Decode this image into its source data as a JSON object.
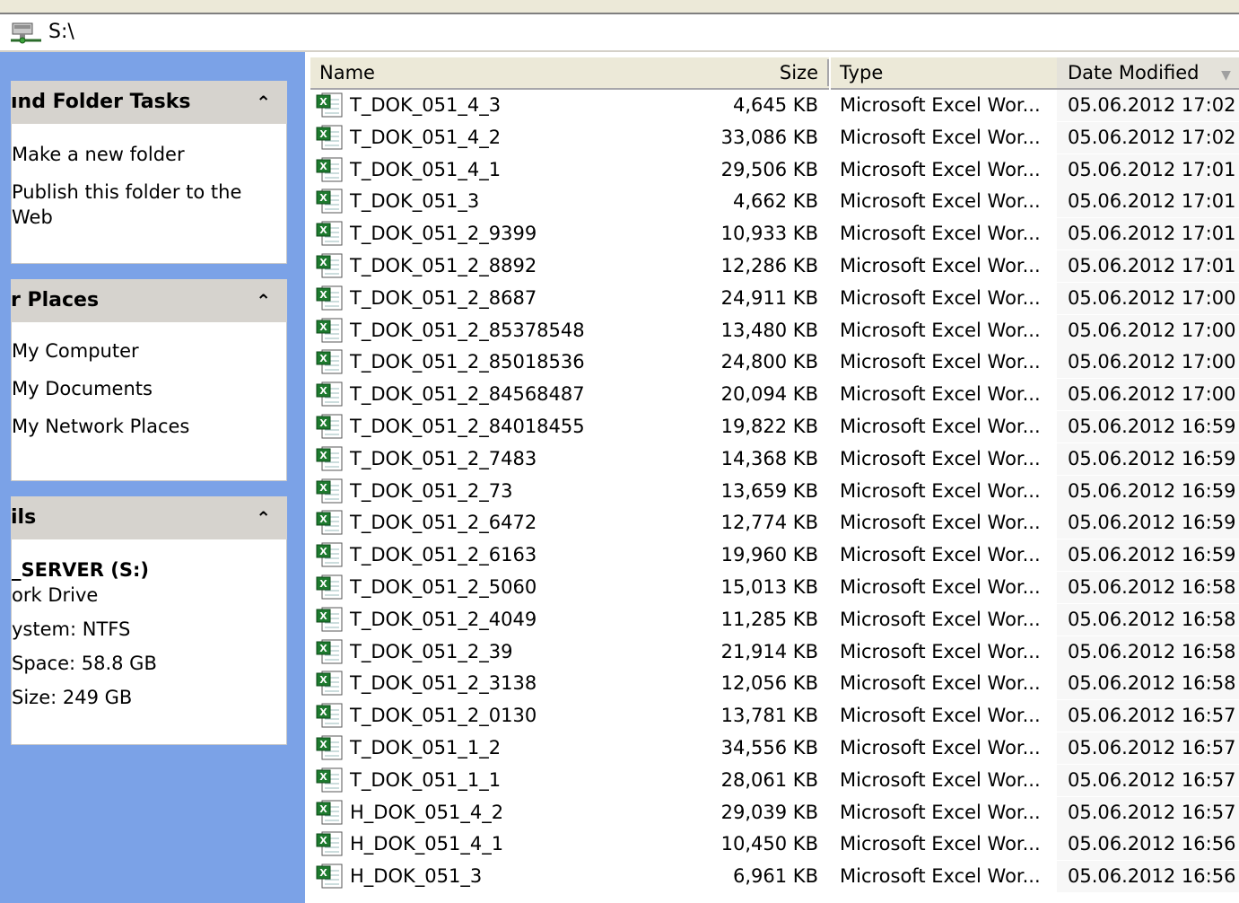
{
  "address": {
    "path": "S:\\",
    "icon": "network-drive-icon"
  },
  "left_pane": {
    "panels": [
      {
        "title": "ınd Folder Tasks",
        "items": [
          "Make a new folder",
          "Publish this folder to the",
          "Web"
        ]
      },
      {
        "title": "r Places",
        "items": [
          "My Computer",
          "My Documents",
          "My Network Places"
        ]
      },
      {
        "title": "ils",
        "details": [
          "_SERVER (S:)",
          "ork Drive",
          "ystem: NTFS",
          "Space: 58.8 GB",
          " Size: 249 GB"
        ]
      }
    ],
    "collapse_glyph": "⌃"
  },
  "listview": {
    "columns": {
      "name": "Name",
      "size": "Size",
      "type": "Type",
      "date": "Date Modified"
    },
    "sort_column": "Date Modified",
    "files": [
      {
        "name": "T_DOK_051_4_3",
        "size": "4,645 KB",
        "type": "Microsoft Excel Wor...",
        "date": "05.06.2012 17:02"
      },
      {
        "name": "T_DOK_051_4_2",
        "size": "33,086 KB",
        "type": "Microsoft Excel Wor...",
        "date": "05.06.2012 17:02"
      },
      {
        "name": "T_DOK_051_4_1",
        "size": "29,506 KB",
        "type": "Microsoft Excel Wor...",
        "date": "05.06.2012 17:01"
      },
      {
        "name": "T_DOK_051_3",
        "size": "4,662 KB",
        "type": "Microsoft Excel Wor...",
        "date": "05.06.2012 17:01"
      },
      {
        "name": "T_DOK_051_2_9399",
        "size": "10,933 KB",
        "type": "Microsoft Excel Wor...",
        "date": "05.06.2012 17:01"
      },
      {
        "name": "T_DOK_051_2_8892",
        "size": "12,286 KB",
        "type": "Microsoft Excel Wor...",
        "date": "05.06.2012 17:01"
      },
      {
        "name": "T_DOK_051_2_8687",
        "size": "24,911 KB",
        "type": "Microsoft Excel Wor...",
        "date": "05.06.2012 17:00"
      },
      {
        "name": "T_DOK_051_2_85378548",
        "size": "13,480 KB",
        "type": "Microsoft Excel Wor...",
        "date": "05.06.2012 17:00"
      },
      {
        "name": "T_DOK_051_2_85018536",
        "size": "24,800 KB",
        "type": "Microsoft Excel Wor...",
        "date": "05.06.2012 17:00"
      },
      {
        "name": "T_DOK_051_2_84568487",
        "size": "20,094 KB",
        "type": "Microsoft Excel Wor...",
        "date": "05.06.2012 17:00"
      },
      {
        "name": "T_DOK_051_2_84018455",
        "size": "19,822 KB",
        "type": "Microsoft Excel Wor...",
        "date": "05.06.2012 16:59"
      },
      {
        "name": "T_DOK_051_2_7483",
        "size": "14,368 KB",
        "type": "Microsoft Excel Wor...",
        "date": "05.06.2012 16:59"
      },
      {
        "name": "T_DOK_051_2_73",
        "size": "13,659 KB",
        "type": "Microsoft Excel Wor...",
        "date": "05.06.2012 16:59"
      },
      {
        "name": "T_DOK_051_2_6472",
        "size": "12,774 KB",
        "type": "Microsoft Excel Wor...",
        "date": "05.06.2012 16:59"
      },
      {
        "name": "T_DOK_051_2_6163",
        "size": "19,960 KB",
        "type": "Microsoft Excel Wor...",
        "date": "05.06.2012 16:59"
      },
      {
        "name": "T_DOK_051_2_5060",
        "size": "15,013 KB",
        "type": "Microsoft Excel Wor...",
        "date": "05.06.2012 16:58"
      },
      {
        "name": "T_DOK_051_2_4049",
        "size": "11,285 KB",
        "type": "Microsoft Excel Wor...",
        "date": "05.06.2012 16:58"
      },
      {
        "name": "T_DOK_051_2_39",
        "size": "21,914 KB",
        "type": "Microsoft Excel Wor...",
        "date": "05.06.2012 16:58"
      },
      {
        "name": "T_DOK_051_2_3138",
        "size": "12,056 KB",
        "type": "Microsoft Excel Wor...",
        "date": "05.06.2012 16:58"
      },
      {
        "name": "T_DOK_051_2_0130",
        "size": "13,781 KB",
        "type": "Microsoft Excel Wor...",
        "date": "05.06.2012 16:57"
      },
      {
        "name": "T_DOK_051_1_2",
        "size": "34,556 KB",
        "type": "Microsoft Excel Wor...",
        "date": "05.06.2012 16:57"
      },
      {
        "name": "T_DOK_051_1_1",
        "size": "28,061 KB",
        "type": "Microsoft Excel Wor...",
        "date": "05.06.2012 16:57"
      },
      {
        "name": "H_DOK_051_4_2",
        "size": "29,039 KB",
        "type": "Microsoft Excel Wor...",
        "date": "05.06.2012 16:57"
      },
      {
        "name": "H_DOK_051_4_1",
        "size": "10,450 KB",
        "type": "Microsoft Excel Wor...",
        "date": "05.06.2012 16:56"
      },
      {
        "name": "H_DOK_051_3",
        "size": "6,961 KB",
        "type": "Microsoft Excel Wor...",
        "date": "05.06.2012 16:56"
      }
    ],
    "file_icon": "excel-file-icon"
  },
  "colors": {
    "task_pane_bg": "#7ba2e7",
    "panel_header": "#d6d3ce",
    "column_header": "#ece9d8"
  }
}
